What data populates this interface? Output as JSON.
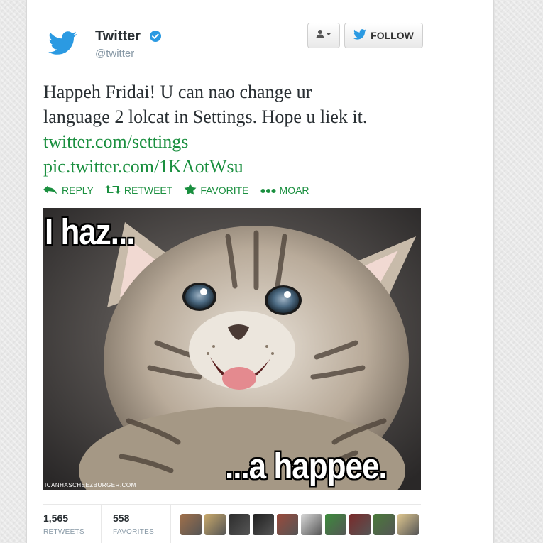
{
  "tweet": {
    "user": {
      "name": "Twitter",
      "handle": "@twitter",
      "verified": true,
      "avatar_icon": "twitter-bird-icon",
      "brand_color": "#2b9ae2"
    },
    "buttons": {
      "user_dropdown_icon": "user-dropdown-icon",
      "follow_label": "FOLLOW",
      "follow_icon": "twitter-bird-icon"
    },
    "text_lines": [
      "Happeh Fridai! U can nao change ur",
      "language 2 lolcat in Settings. Hope u liek it."
    ],
    "links": [
      "twitter.com/settings",
      "pic.twitter.com/1KAotWsu"
    ],
    "link_color": "#1a8f3f",
    "actions": [
      {
        "icon": "reply-icon",
        "label": "REPLY"
      },
      {
        "icon": "retweet-icon",
        "label": "RETWEET"
      },
      {
        "icon": "star-icon",
        "label": "FAVORITE"
      },
      {
        "icon": "more-dots-icon",
        "label": "MOAR"
      }
    ],
    "media": {
      "caption_top": "I haz...",
      "caption_bottom": "...a happee.",
      "watermark": "ICANHASCHEEZBURGER.COM"
    },
    "stats": {
      "retweets_count": "1,565",
      "retweets_label": "RETWEETS",
      "favorites_count": "558",
      "favorites_label": "FAVORITES"
    },
    "favoriter_avatars": [
      {
        "icon": "user-avatar-1",
        "color": "#a0704a"
      },
      {
        "icon": "user-avatar-2",
        "color": "#c9a96b"
      },
      {
        "icon": "user-avatar-3",
        "color": "#2d2d2d"
      },
      {
        "icon": "user-avatar-4",
        "color": "#1f1f1f"
      },
      {
        "icon": "user-avatar-5",
        "color": "#9a4a3c"
      },
      {
        "icon": "user-avatar-6",
        "color": "#d8d8d8"
      },
      {
        "icon": "user-avatar-7",
        "color": "#3c8c3c"
      },
      {
        "icon": "user-avatar-8",
        "color": "#7a2a2a"
      },
      {
        "icon": "user-avatar-9",
        "color": "#4a7a3a"
      },
      {
        "icon": "user-avatar-10",
        "color": "#e0c890"
      }
    ]
  }
}
